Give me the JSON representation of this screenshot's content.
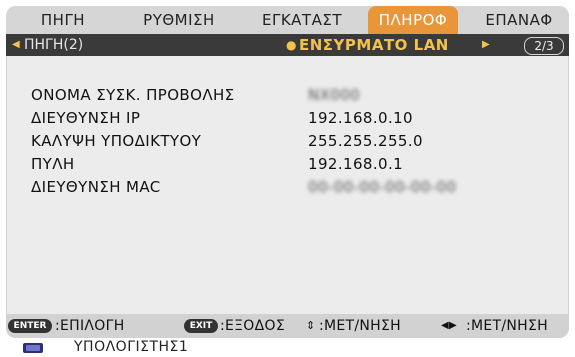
{
  "tabs": [
    {
      "label": "ΠΗΓΗ",
      "active": false
    },
    {
      "label": "ΡΥΘΜΙΣΗ",
      "active": false
    },
    {
      "label": "ΕΓΚΑΤΑΣΤ",
      "active": false
    },
    {
      "label": "ΠΛΗΡΟΦ",
      "active": true
    },
    {
      "label": "ΕΠΑΝΑΦ",
      "active": false
    }
  ],
  "subbar": {
    "prev_label": "ΠΗΓΗ(2)",
    "current_label": "ΕΝΣΥΡΜΑΤΟ LAN",
    "page_indicator": "2/3"
  },
  "info": [
    {
      "label": "ΟΝΟΜΑ ΣΥΣΚ. ΠΡΟΒΟΛΗΣ",
      "value": "NX000",
      "blurred": true
    },
    {
      "label": "ΔΙΕΥΘΥΝΣΗ IP",
      "value": "192.168.0.10",
      "blurred": false
    },
    {
      "label": "ΚΑΛΥΨΗ ΥΠΟΔΙΚΤΥΟΥ",
      "value": "255.255.255.0",
      "blurred": false
    },
    {
      "label": "ΠΥΛΗ",
      "value": "192.168.0.1",
      "blurred": false
    },
    {
      "label": "ΔΙΕΥΘΥΝΣΗ MAC",
      "value": "00-00-00-00-00-00",
      "blurred": true
    }
  ],
  "hints": {
    "enter_key": "ENTER",
    "enter_label": ":ΕΠΙΛΟΓΗ",
    "exit_key": "EXIT",
    "exit_label": ":ΕΞΟΔΟΣ",
    "updown_label": ":ΜΕΤ/ΝΗΣΗ",
    "leftright_label": ":ΜΕΤ/ΝΗΣΗ"
  },
  "footer": {
    "source_label": "ΥΠΟΛΟΓΙΣΤΗΣ1"
  },
  "colors": {
    "active_tab": "#e9963a",
    "accent": "#f3c24a",
    "subbar_bg": "#3a3a3a"
  }
}
